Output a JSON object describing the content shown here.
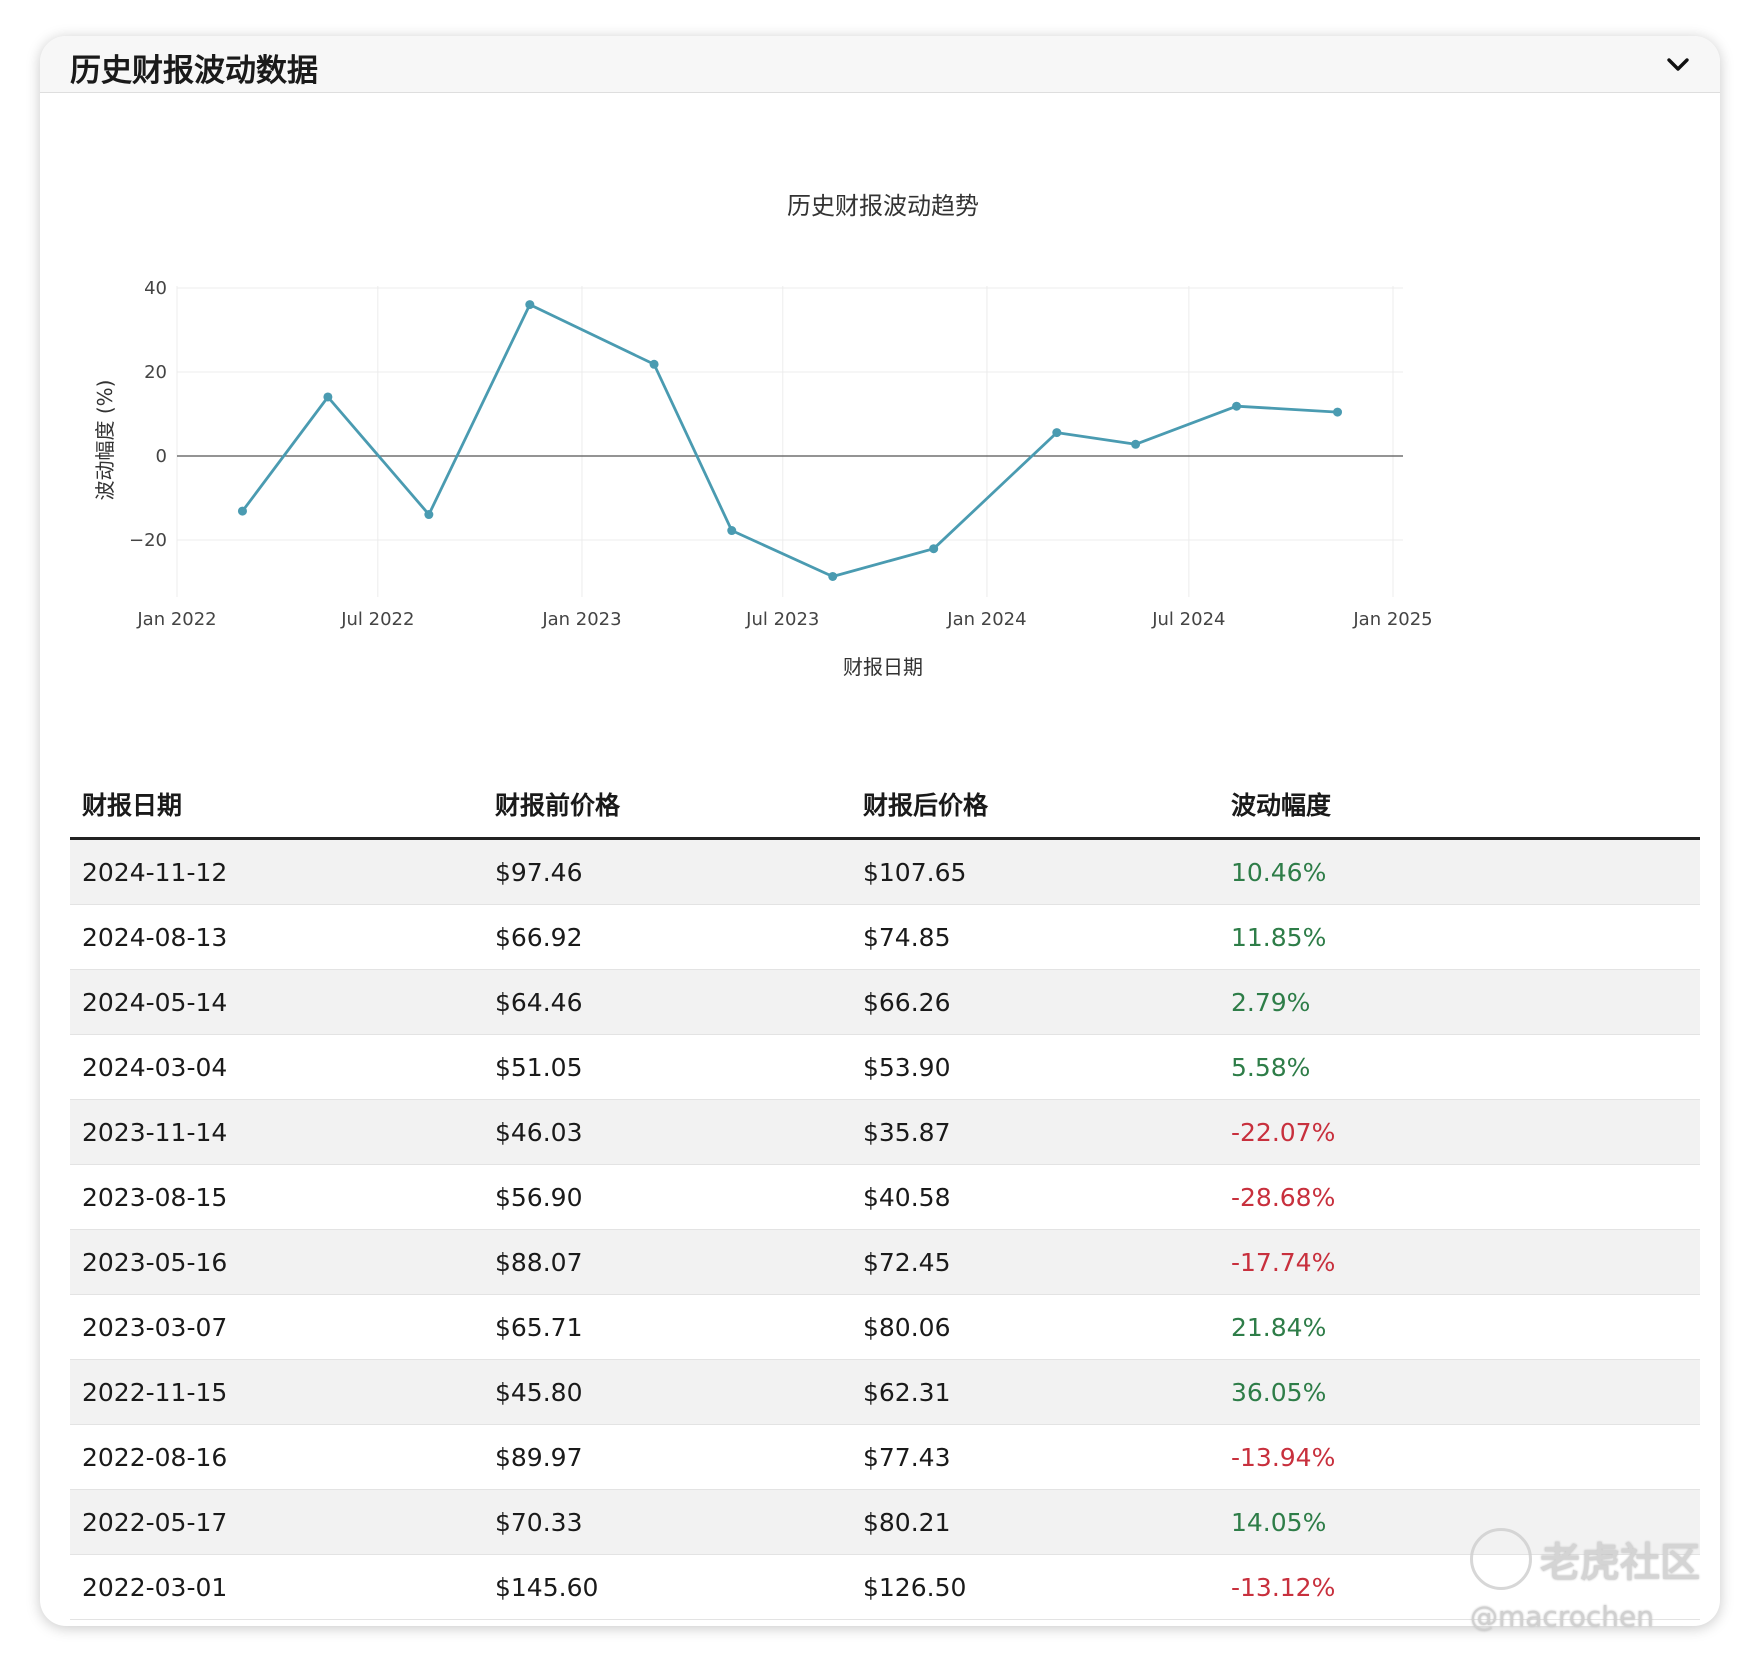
{
  "panel": {
    "title": "历史财报波动数据"
  },
  "icons": {
    "collapse": "chevron-down-icon"
  },
  "colors": {
    "line": "#4a9bb1",
    "positive": "#2e7d48",
    "negative": "#c8303d",
    "grid": "#ececec"
  },
  "chart_data": {
    "type": "line",
    "title": "历史财报波动趋势",
    "xlabel": "财报日期",
    "ylabel": "波动幅度 (%)",
    "ylim": [
      -29.5,
      40
    ],
    "yticks": [
      40,
      20,
      0,
      -20
    ],
    "ytick_labels": [
      "40",
      "20",
      "0",
      "−20"
    ],
    "xticks": [
      "2022-01-01",
      "2022-07-01",
      "2023-01-01",
      "2023-07-01",
      "2024-01-01",
      "2024-07-01",
      "2025-01-01"
    ],
    "xtick_labels": [
      "Jan 2022",
      "Jul 2022",
      "Jan 2023",
      "Jul 2023",
      "Jan 2024",
      "Jul 2024",
      "Jan 2025"
    ],
    "xlim": [
      "2022-01-01",
      "2025-01-01"
    ],
    "grid": true,
    "series": [
      {
        "x": [
          "2022-03-01",
          "2022-05-17",
          "2022-08-16",
          "2022-11-15",
          "2023-03-07",
          "2023-05-16",
          "2023-08-15",
          "2023-11-14",
          "2024-03-04",
          "2024-05-14",
          "2024-08-13",
          "2024-11-12"
        ],
        "y": [
          -13.12,
          14.05,
          -13.94,
          36.05,
          21.84,
          -17.74,
          -28.68,
          -22.07,
          5.58,
          2.79,
          11.85,
          10.46
        ]
      }
    ]
  },
  "table": {
    "headers": [
      "财报日期",
      "财报前价格",
      "财报后价格",
      "波动幅度"
    ],
    "rows": [
      {
        "date": "2024-11-12",
        "before": "$97.46",
        "after": "$107.65",
        "change": "10.46%",
        "sign": "pos"
      },
      {
        "date": "2024-08-13",
        "before": "$66.92",
        "after": "$74.85",
        "change": "11.85%",
        "sign": "pos"
      },
      {
        "date": "2024-05-14",
        "before": "$64.46",
        "after": "$66.26",
        "change": "2.79%",
        "sign": "pos"
      },
      {
        "date": "2024-03-04",
        "before": "$51.05",
        "after": "$53.90",
        "change": "5.58%",
        "sign": "pos"
      },
      {
        "date": "2023-11-14",
        "before": "$46.03",
        "after": "$35.87",
        "change": "-22.07%",
        "sign": "neg"
      },
      {
        "date": "2023-08-15",
        "before": "$56.90",
        "after": "$40.58",
        "change": "-28.68%",
        "sign": "neg"
      },
      {
        "date": "2023-05-16",
        "before": "$88.07",
        "after": "$72.45",
        "change": "-17.74%",
        "sign": "neg"
      },
      {
        "date": "2023-03-07",
        "before": "$65.71",
        "after": "$80.06",
        "change": "21.84%",
        "sign": "pos"
      },
      {
        "date": "2022-11-15",
        "before": "$45.80",
        "after": "$62.31",
        "change": "36.05%",
        "sign": "pos"
      },
      {
        "date": "2022-08-16",
        "before": "$89.97",
        "after": "$77.43",
        "change": "-13.94%",
        "sign": "neg"
      },
      {
        "date": "2022-05-17",
        "before": "$70.33",
        "after": "$80.21",
        "change": "14.05%",
        "sign": "pos"
      },
      {
        "date": "2022-03-01",
        "before": "$145.60",
        "after": "$126.50",
        "change": "-13.12%",
        "sign": "neg"
      }
    ]
  },
  "watermark": {
    "brand": "老虎社区",
    "user": "@macrochen",
    "logo": "tiger-logo-icon"
  }
}
